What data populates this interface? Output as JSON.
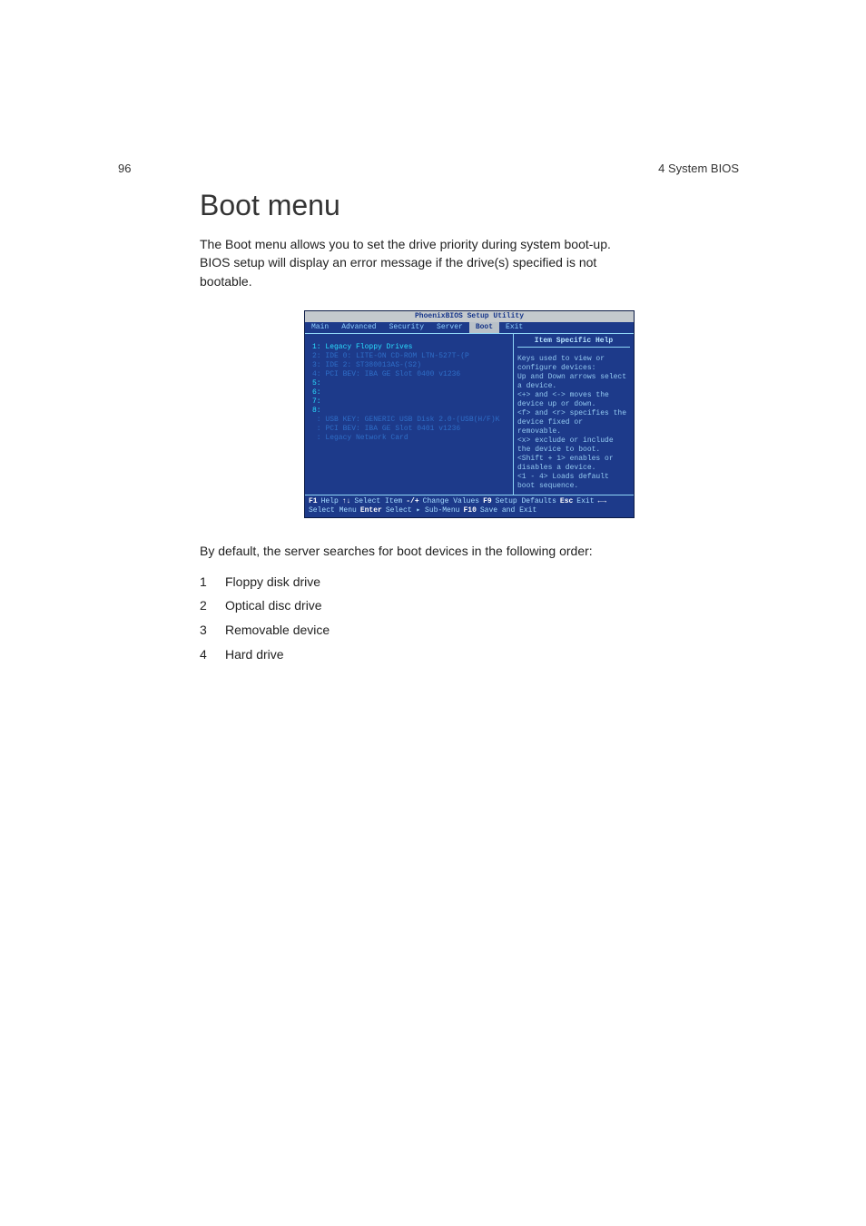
{
  "page_header": {
    "page_number": "96",
    "section": "4 System BIOS"
  },
  "title": "Boot menu",
  "intro": "The Boot menu allows you to set the drive priority during system boot-up.  BIOS setup will display an error message if the drive(s) specified is not bootable.",
  "bios": {
    "app_title": "PhoenixBIOS Setup Utility",
    "tabs": [
      "Main",
      "Advanced",
      "Security",
      "Server",
      "Boot",
      "Exit"
    ],
    "active_tab": "Boot",
    "boot_entries": [
      {
        "idx": "1:",
        "label": "Legacy Floppy Drives",
        "dim": false
      },
      {
        "idx": "2:",
        "label": "IDE 0: LITE-ON CD-ROM LTN-527T-(P",
        "dim": true
      },
      {
        "idx": "3:",
        "label": "IDE 2: ST380013AS-(S2)",
        "dim": true
      },
      {
        "idx": "4:",
        "label": "PCI BEV: IBA GE Slot 0400 v1236",
        "dim": true
      },
      {
        "idx": "5:",
        "label": "",
        "dim": false
      },
      {
        "idx": "6:",
        "label": "",
        "dim": false
      },
      {
        "idx": "7:",
        "label": "",
        "dim": false
      },
      {
        "idx": "8:",
        "label": "",
        "dim": false
      },
      {
        "idx": " :",
        "label": "USB KEY: GENERIC USB Disk 2.0-(USB(H/F)K",
        "dim": true
      },
      {
        "idx": " :",
        "label": "PCI BEV: IBA GE Slot 0401 v1236",
        "dim": true
      },
      {
        "idx": " :",
        "label": "Legacy Network Card",
        "dim": true
      }
    ],
    "help_title": "Item Specific Help",
    "help_body": "Keys used to view or configure devices:\nUp and Down arrows select a device.\n<+> and <-> moves the device up or down.\n<f> and <r> specifies the device fixed or removable.\n<x> exclude or include the device to boot.\n<Shift + 1> enables or disables a device.\n<1 - 4> Loads default boot sequence.",
    "footer": {
      "f1": "F1",
      "help": "Help",
      "arrows_v": "↑↓",
      "select_item": "Select Item",
      "plusminus": "-/+",
      "change_values": "Change Values",
      "f9": "F9",
      "setup_defaults": "Setup Defaults",
      "esc": "Esc",
      "exit": "Exit",
      "arrows_h": "←→",
      "select_menu": "Select Menu",
      "enter": "Enter",
      "select_submenu": "Select ▸ Sub-Menu",
      "f10": "F10",
      "save_exit": "Save and Exit"
    }
  },
  "body_para": "By default, the server searches for boot devices in the following order:",
  "order_list": [
    "Floppy disk drive",
    "Optical disc drive",
    "Removable device",
    "Hard drive"
  ]
}
